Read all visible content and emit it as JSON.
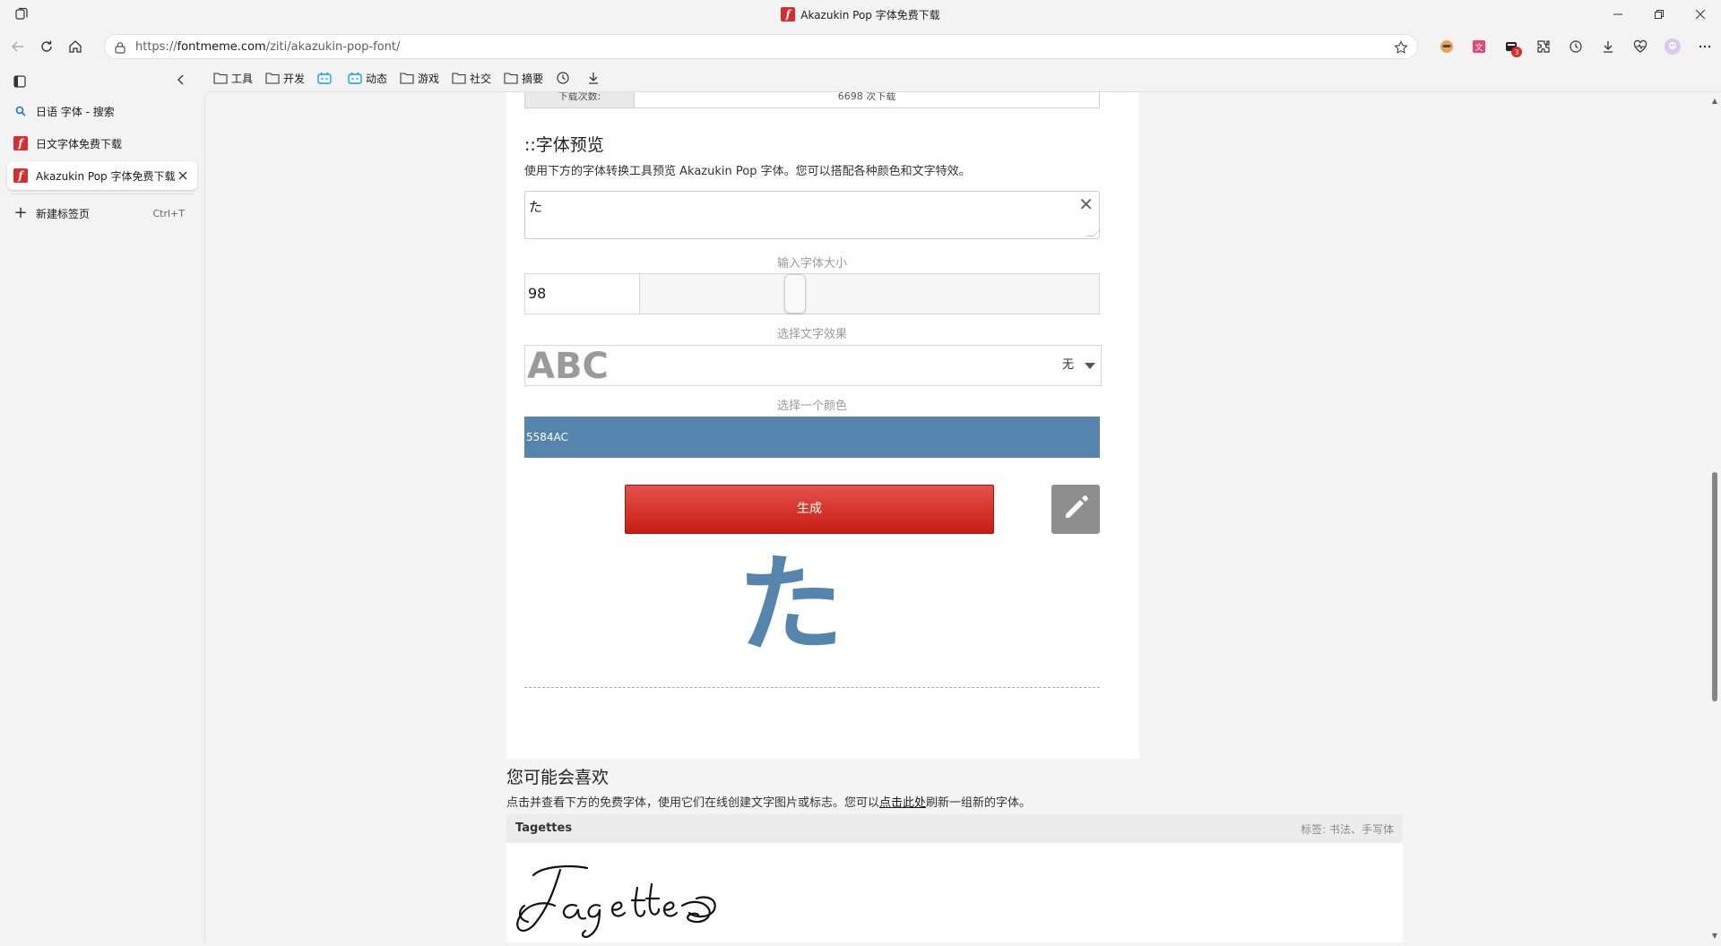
{
  "window": {
    "title": "Akazukin Pop 字体免费下载",
    "favicon_letter": "f"
  },
  "address_bar": {
    "url_prefix": "https://",
    "url_host": "fontmeme.com",
    "url_path": "/ziti/akazukin-pop-font/"
  },
  "extensions": {
    "badge_count": "3"
  },
  "sidebar": {
    "tabs": [
      {
        "label": "日语 字体 - 搜索",
        "icon": "search-icon",
        "active": false
      },
      {
        "label": "日文字体免费下载",
        "icon": "fontmeme-icon",
        "active": false
      },
      {
        "label": "Akazukin Pop 字体免费下载",
        "icon": "fontmeme-icon",
        "active": true
      }
    ],
    "new_tab_label": "新建标签页",
    "new_tab_shortcut": "Ctrl+T"
  },
  "favorites": [
    {
      "label": "工具",
      "icon": "folder-icon"
    },
    {
      "label": "开发",
      "icon": "folder-icon"
    },
    {
      "label": "",
      "icon": "bilibili-icon"
    },
    {
      "label": "动态",
      "icon": "bilibili-icon"
    },
    {
      "label": "游戏",
      "icon": "folder-icon"
    },
    {
      "label": "社交",
      "icon": "folder-icon"
    },
    {
      "label": "摘要",
      "icon": "folder-icon"
    },
    {
      "label": "",
      "icon": "history-icon"
    },
    {
      "label": "",
      "icon": "download-icon"
    }
  ],
  "page": {
    "downloads_label": "下载次数:",
    "downloads_value": "6698 次下载",
    "preview_title": "::字体预览",
    "preview_desc": "使用下方的字体转换工具预览 Akazukin Pop 字体。您可以搭配各种颜色和文字特效。",
    "preview_text": "た",
    "size_label": "输入字体大小",
    "size_value": "98",
    "size_slider_fraction": 0.33,
    "effect_label": "选择文字效果",
    "effect_sample": "ABC",
    "effect_value": "无",
    "color_label": "选择一个颜色",
    "color_value": "5584AC",
    "color_hex": "#5584AC",
    "generate_label": "生成",
    "preview_glyph": "た",
    "like_title": "您可能会喜欢",
    "like_desc_pre": "点击并查看下方的免费字体，使用它们在线创建文字图片或标志。您可以",
    "like_desc_link": "点击此处",
    "like_desc_post": "刷新一组新的字体。",
    "font_card": {
      "name": "Tagettes",
      "tags": "标签: 书法、手写体"
    }
  },
  "colors": {
    "accent": "#5584AC",
    "generate_red": "#D52A22",
    "favicon_red": "#D62E2E"
  }
}
